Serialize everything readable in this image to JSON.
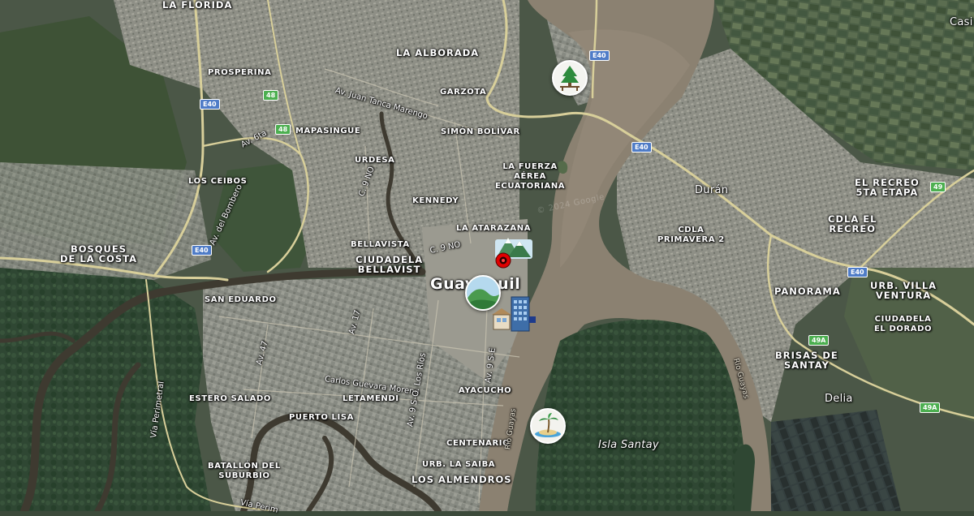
{
  "map": {
    "city": "Guayaquil",
    "island": "Isla Santay",
    "river": "Río Guayas",
    "watermark": "© 2024 Google",
    "colors": {
      "land": "#4b5747",
      "mangrove": "#2b4430",
      "urban": "#8b8e86",
      "river": "#8b8171",
      "road": "#d8cf9a",
      "e40_shield": "#4f7cc7",
      "local_shield": "#4caf50",
      "pin": "#e00000"
    }
  },
  "labels": {
    "la_florida": "LA FLORIDA",
    "la_alborada": "LA ALBORADA",
    "prosperina": "PROSPERINA",
    "garzota": "GARZOTA",
    "simon_bolivar": "SIMÓN BOLÍVAR",
    "mapasingue": "MAPASINGUE",
    "urdesa": "URDESA",
    "la_fuerza_aerea": "LA FUERZA\nAÉREA\nECUATORIANA",
    "los_ceibos": "LOS CEIBOS",
    "kennedy": "KENNEDY",
    "la_atarazana": "LA ATARAZANA",
    "bosques": "BOSQUES\nDE LA COSTA",
    "bellavista": "BELLAVISTA",
    "ciudadela_bellavista": "CIUDADELA\nBELLAVIST",
    "san_eduardo": "SAN EDUARDO",
    "estero_salado": "ESTERO SALADO",
    "letamendi": "LETAMENDI",
    "ayacucho": "AYACUCHO",
    "puerto_lisa": "PUERTO LISA",
    "centenario": "CENTENARIO",
    "batallon": "BATALLÓN DEL\nSUBURBIO",
    "urb_la_saiba": "URB. LA SAIBA",
    "los_almendros": "LOS ALMENDROS",
    "duran": "Durán",
    "el_recreo_5ta": "EL RECREO\n5TA ETAPA",
    "cdla_el_recreo": "CDLA EL\nRECREO",
    "cdla_primavera": "CDLA\nPRIMAVERA 2",
    "panorama": "PANORAMA",
    "urb_villa_ventura": "URB. VILLA\nVENTURA",
    "ciudadela_el_dorado": "CIUDADELA\nEL DORADO",
    "brisas_de_santay": "BRISAS DE\nSANTAY",
    "delia": "Delia",
    "casi": "Casi"
  },
  "streets": {
    "juan_tanca": "Av. Juan Tanca Marengo",
    "av_6ta": "Av. 6ta",
    "av_del_bombero": "Av. del Bombero",
    "c_9_no_a": "C. 9 NO",
    "c_9_no_b": "C. 9 NO",
    "av_17": "Av. 17",
    "av_47": "Av. 47",
    "carlos_guevara": "Carlos Guevara Moreno",
    "av_9_so_los_rios": "Av. 9 S-O. Los Ríos",
    "av_9_se": "Av. 9 S-E",
    "via_perimetral": "Vía Perimetral",
    "via_perim_bottom": "Vía Perim"
  },
  "shields": {
    "e40_a": "E40",
    "e40_b": "E40",
    "e40_c": "E40",
    "e40_d": "E40",
    "e40_e": "E40",
    "r48_a": "48",
    "r48_b": "48",
    "r49": "49",
    "r49a_a": "49A",
    "r49a_b": "49A"
  },
  "markers": [
    {
      "name": "park-picnic",
      "icon": "tree-picnic-icon"
    },
    {
      "name": "mountain-viewpoint",
      "icon": "mountain-icon"
    },
    {
      "name": "location-pin",
      "icon": "map-pin-icon"
    },
    {
      "name": "green-hill",
      "icon": "hill-icon"
    },
    {
      "name": "city-buildings",
      "icon": "building-icon"
    },
    {
      "name": "island-beach",
      "icon": "palm-island-icon"
    }
  ]
}
